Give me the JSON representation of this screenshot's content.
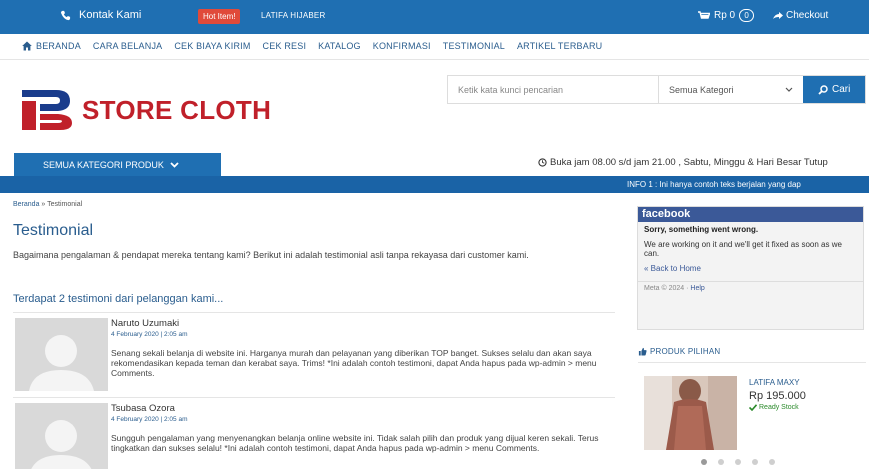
{
  "topbar": {
    "contact": "Kontak Kami",
    "hot_badge": "Hot Item!",
    "hot_text": "LATIFA HIJABER",
    "cart_total": "Rp 0",
    "cart_count": "0",
    "checkout": "Checkout"
  },
  "nav": {
    "items": [
      {
        "label": "BERANDA",
        "icon": "home-icon"
      },
      {
        "label": "CARA BELANJA"
      },
      {
        "label": "CEK BIAYA KIRIM"
      },
      {
        "label": "CEK RESI"
      },
      {
        "label": "KATALOG"
      },
      {
        "label": "KONFIRMASI"
      },
      {
        "label": "TESTIMONIAL"
      },
      {
        "label": "ARTIKEL TERBARU"
      }
    ]
  },
  "header": {
    "logo_text": "STORE CLOTH",
    "search_placeholder": "Ketik kata kunci pencarian",
    "category_select": "Semua Kategori",
    "search_button": "Cari"
  },
  "catbar": {
    "button": "SEMUA KATEGORI PRODUK",
    "hours": "Buka jam 08.00 s/d jam 21.00 , Sabtu, Minggu & Hari Besar Tutup",
    "ticker": "INFO 1 : Ini hanya contoh teks berjalan yang dap"
  },
  "main": {
    "breadcrumb_home": "Beranda",
    "breadcrumb_sep": "»",
    "breadcrumb_current": "Testimonial",
    "title": "Testimonial",
    "intro": "Bagaimana pengalaman & pendapat mereka tentang kami? Berikut ini adalah testimonial asli tanpa rekayasa dari customer kami.",
    "count_heading": "Terdapat 2 testimoni dari pelanggan kami...",
    "comments": [
      {
        "name": "Naruto Uzumaki",
        "date": "4 February 2020 | 2:05 am",
        "text": "Senang sekali belanja di website ini. Harganya murah dan pelayanan yang diberikan TOP banget. Sukses selalu dan akan saya rekomendasikan kepada teman dan kerabat saya. Trims! *Ini adalah contoh testimoni, dapat Anda hapus pada wp-admin > menu Comments."
      },
      {
        "name": "Tsubasa Ozora",
        "date": "4 February 2020 | 2:05 am",
        "text": "Sungguh pengalaman yang menyenangkan belanja online website ini. Tidak salah pilih dan produk yang dijual keren sekali. Terus tingkatkan dan sukses selalu! *Ini adalah contoh testimoni, dapat Anda hapus pada wp-admin > menu Comments."
      }
    ]
  },
  "sidebar": {
    "fb_title": "facebook",
    "fb_error": "Sorry, something went wrong.",
    "fb_message": "We are working on it and we'll get it fixed as soon as we can.",
    "fb_back": "« Back to Home",
    "fb_meta": "Meta © 2024 ·",
    "fb_help": "Help",
    "product_heading": "PRODUK PILIHAN",
    "product_name": "LATIFA MAXY",
    "product_price": "Rp 195.000",
    "product_stock": "Ready Stock"
  },
  "colors": {
    "primary": "#1f6fb2",
    "hot": "#e04a3a",
    "logo": "#c0202a",
    "facebook": "#3b5998"
  }
}
